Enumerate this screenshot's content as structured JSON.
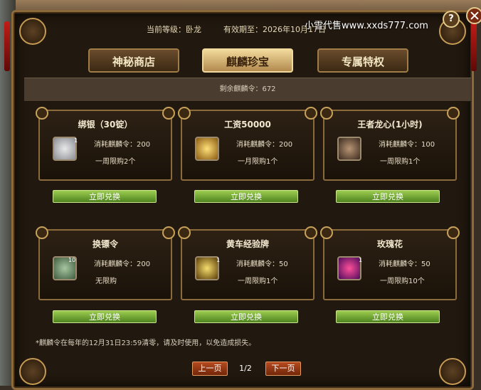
{
  "header": {
    "level": "当前等级：卧龙",
    "expire": "有效期至：2026年10月17日",
    "watermark": "小雪代售www.xxds777.com",
    "help_label": "?"
  },
  "tabs": [
    {
      "label": "神秘商店",
      "active": false
    },
    {
      "label": "麒麟珍宝",
      "active": true
    },
    {
      "label": "专属特权",
      "active": false
    }
  ],
  "remaining": "剩余麒麟令：672",
  "items": [
    {
      "title": "绑银（30锭）",
      "cost": "消耗麒麟令：200",
      "limit": "一周限购2个",
      "qty": "1",
      "icon": "silver-ingot-icon",
      "color": "#a9acb0"
    },
    {
      "title": "工资50000",
      "cost": "消耗麒麟令：200",
      "limit": "一月限购1个",
      "qty": "",
      "icon": "gold-pouch-icon",
      "color": "#d9a224"
    },
    {
      "title": "王者龙心(1小时)",
      "cost": "消耗麒麟令：100",
      "limit": "一周限购1个",
      "qty": "",
      "icon": "dragon-heart-icon",
      "color": "#7c5f47"
    },
    {
      "title": "换镖令",
      "cost": "消耗麒麟令：200",
      "limit": "无限购",
      "qty": "10",
      "icon": "escort-token-icon",
      "color": "#6e8c6a"
    },
    {
      "title": "黄车经验牌",
      "cost": "消耗麒麟令：50",
      "limit": "一周限购1个",
      "qty": "1",
      "icon": "exp-tablet-icon",
      "color": "#c9a131"
    },
    {
      "title": "玫瑰花",
      "cost": "消耗麒麟令：50",
      "limit": "一周限购10个",
      "qty": "1",
      "icon": "rose-icon",
      "color": "#b13bb5"
    }
  ],
  "exchange_label": "立即兑换",
  "note": "*麒麟令在每年的12月31日23:59清零，请及时使用，以免造成损失。",
  "pagination": {
    "prev": "上一页",
    "page": "1/2",
    "next": "下一页"
  }
}
